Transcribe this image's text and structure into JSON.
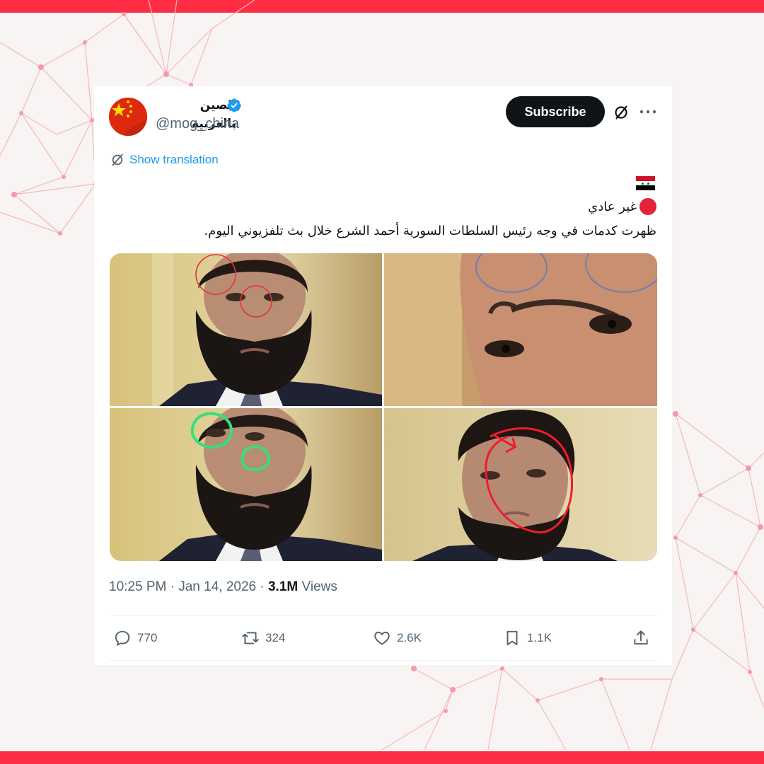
{
  "tweet": {
    "display_name": "الصين بالعربية",
    "handle": "@mog_china",
    "subscribe_label": "Subscribe",
    "show_translation": "Show translation",
    "text_line_status": "غير عادي",
    "text_body": "ظهرت كدمات في وجه رئيس السلطات السورية أحمد الشرع خلال بث تلفزيوني اليوم.",
    "flag_icon": "syria-flag-emoji",
    "time": "10:25 PM",
    "separator": "·",
    "date": "Jan 14, 2026",
    "views_count": "3.1M",
    "views_label": "Views"
  },
  "actions": {
    "replies": "770",
    "retweets": "324",
    "likes": "2.6K",
    "bookmarks": "1.1K"
  },
  "colors": {
    "accent_bar": "#ff2d44",
    "verified_blue": "#1d9bf0",
    "subscribe_bg": "#0f1419",
    "status_red": "#e4233a",
    "link_blue": "#1d9bf0"
  }
}
